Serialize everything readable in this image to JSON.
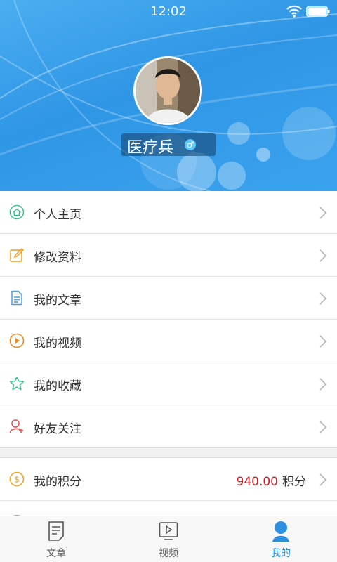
{
  "status_bar": {
    "time": "12:02"
  },
  "profile": {
    "name": "医疗兵",
    "gender_symbol": "♂"
  },
  "menu": [
    {
      "label": "个人主页",
      "icon": "home-icon"
    },
    {
      "label": "修改资料",
      "icon": "edit-icon"
    },
    {
      "label": "我的文章",
      "icon": "document-icon"
    },
    {
      "label": "我的视频",
      "icon": "play-icon"
    },
    {
      "label": "我的收藏",
      "icon": "star-icon"
    },
    {
      "label": "好友关注",
      "icon": "add-friend-icon"
    }
  ],
  "points_row": {
    "label": "我的积分",
    "value": "940.00",
    "unit": "积分",
    "icon": "coin-icon"
  },
  "tabs": [
    {
      "label": "文章",
      "icon": "article-icon",
      "active": false
    },
    {
      "label": "视频",
      "icon": "video-icon",
      "active": false
    },
    {
      "label": "我的",
      "icon": "user-icon",
      "active": true
    }
  ],
  "colors": {
    "accent": "#2c8fe0",
    "header": "#3a9fea",
    "points": "#d0191f"
  }
}
